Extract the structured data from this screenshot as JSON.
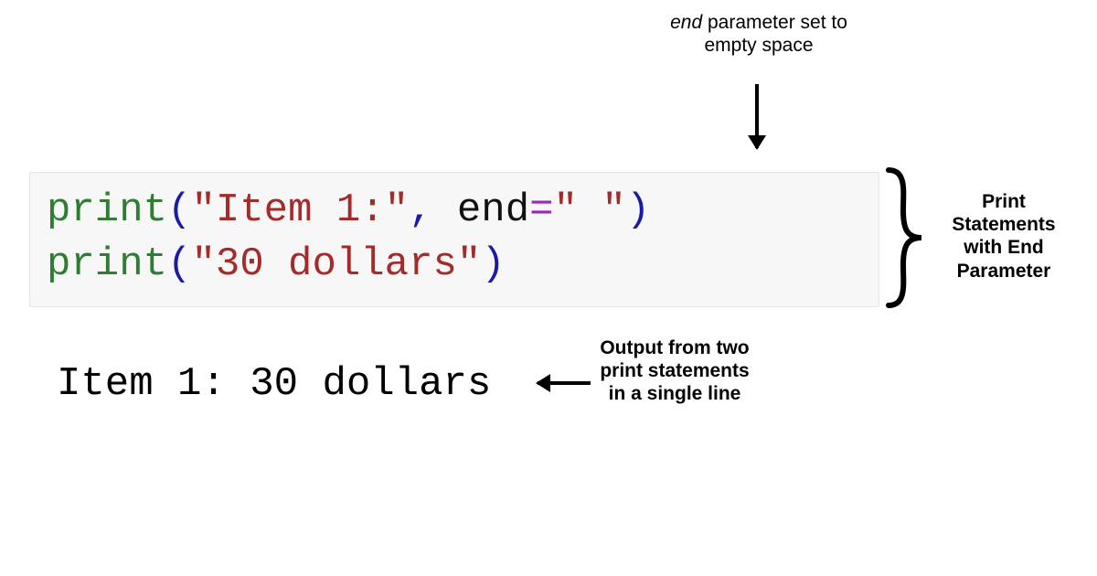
{
  "annotations": {
    "top_prefix_italic": "end",
    "top_rest": " parameter set to empty space",
    "right": "Print Statements with End Parameter",
    "bottom": "Output from two print statements in a single line"
  },
  "code": {
    "line1": {
      "func": "print",
      "open": "(",
      "str": "\"Item 1:\"",
      "comma": ", ",
      "kw": "end",
      "eq": "=",
      "val": "\" \"",
      "close": ")"
    },
    "line2": {
      "func": "print",
      "open": "(",
      "str": "\"30 dollars\"",
      "close": ")"
    }
  },
  "output": "Item 1: 30 dollars"
}
